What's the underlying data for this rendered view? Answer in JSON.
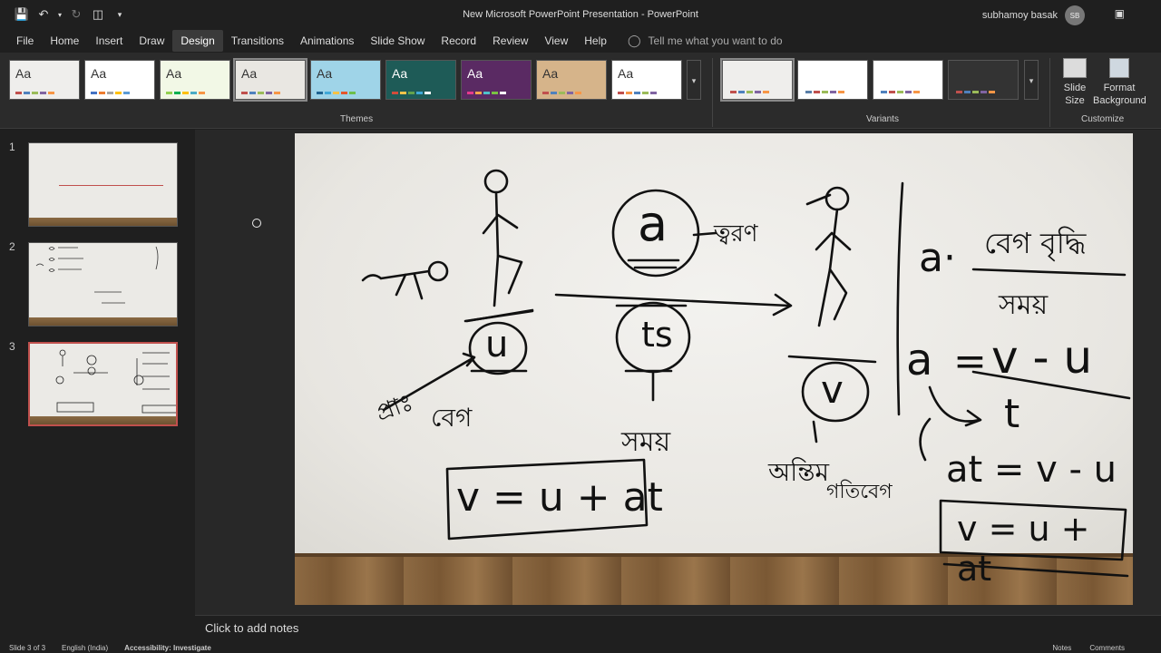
{
  "window": {
    "title": "New Microsoft PowerPoint Presentation  -  PowerPoint",
    "user_name": "subhamoy basak",
    "user_initials": "SB"
  },
  "menu": {
    "tabs": [
      "File",
      "Home",
      "Insert",
      "Draw",
      "Design",
      "Transitions",
      "Animations",
      "Slide Show",
      "Record",
      "Review",
      "View",
      "Help"
    ],
    "active_tab": "Design",
    "tell_me_placeholder": "Tell me what you want to do"
  },
  "ribbon": {
    "themes_label": "Themes",
    "variants_label": "Variants",
    "customize_label": "Customize",
    "slide_size_label": "Slide Size",
    "format_background_label": "Format Background",
    "theme_thumbnail_text": "Aa",
    "themes": [
      {
        "bg": "#efeeec",
        "fg": "#333333",
        "bars": [
          "#c0504d",
          "#4f81bd",
          "#9bbb59",
          "#8064a2",
          "#f79646"
        ]
      },
      {
        "bg": "#ffffff",
        "fg": "#333333",
        "bars": [
          "#4472c4",
          "#ed7d31",
          "#a5a5a5",
          "#ffc000",
          "#5b9bd5"
        ]
      },
      {
        "bg": "#f2f8e6",
        "fg": "#333333",
        "bars": [
          "#92d050",
          "#00b050",
          "#ffc000",
          "#4aacc6",
          "#f79646"
        ]
      },
      {
        "bg": "#e9e7e2",
        "fg": "#333333",
        "bars": [
          "#c0504d",
          "#4f81bd",
          "#9bbb59",
          "#8064a2",
          "#f79646"
        ]
      },
      {
        "bg": "#9fd4e8",
        "fg": "#333333",
        "bars": [
          "#1f6391",
          "#3fa9d8",
          "#f6c244",
          "#e5562c",
          "#6cbf4b"
        ]
      },
      {
        "bg": "#1e5b57",
        "fg": "#ffffff",
        "bars": [
          "#d14c3b",
          "#f1c24a",
          "#63a24c",
          "#3fa9d8",
          "#ffffff"
        ]
      },
      {
        "bg": "#5a2a63",
        "fg": "#ffffff",
        "bars": [
          "#e53a8c",
          "#f3a64a",
          "#4ec1ca",
          "#7ac142",
          "#ffffff"
        ]
      },
      {
        "bg": "#d6b48a",
        "fg": "#333333",
        "bars": [
          "#c0504d",
          "#4f81bd",
          "#9bbb59",
          "#8064a2",
          "#f79646"
        ]
      },
      {
        "bg": "#ffffff",
        "fg": "#333333",
        "bars": [
          "#c0504d",
          "#f79646",
          "#4f81bd",
          "#9bbb59",
          "#8064a2"
        ]
      }
    ],
    "variants": [
      {
        "bg": "#efeeec",
        "bars": [
          "#c0504d",
          "#4f81bd",
          "#9bbb59",
          "#8064a2",
          "#f79646"
        ]
      },
      {
        "bg": "#ffffff",
        "bars": [
          "#5a7fa8",
          "#c0504d",
          "#9bbb59",
          "#8064a2",
          "#f79646"
        ]
      },
      {
        "bg": "#ffffff",
        "bars": [
          "#4f81bd",
          "#c0504d",
          "#9bbb59",
          "#8064a2",
          "#f79646"
        ]
      },
      {
        "bg": "#333333",
        "bars": [
          "#c0504d",
          "#4f81bd",
          "#9bbb59",
          "#8064a2",
          "#f79646"
        ]
      }
    ]
  },
  "slides": {
    "numbers": [
      "1",
      "2",
      "3"
    ],
    "selected": 3
  },
  "slide3": {
    "handwriting": {
      "accel_symbol": "a",
      "accel_word": "ত্বরণ",
      "definition_top": "বেগ বৃদ্ধি",
      "definition_bottom": "সময়",
      "time_symbol": "ts",
      "time_word": "সময়",
      "init_symbol": "u",
      "init_word_1": "প্রাঃ",
      "init_word_2": "বেগ",
      "final_symbol": "v",
      "final_word_1": "অন্তিম",
      "final_word_2": "গতিবেগ",
      "formula_a_lhs": "a",
      "formula_a_num": "v - u",
      "formula_a_den": "t",
      "formula_at": "at = v - u",
      "result": "v = u + at"
    }
  },
  "notes": {
    "placeholder": "Click to add notes"
  },
  "status": {
    "slide_position": "Slide 3 of 3",
    "language": "English (India)",
    "accessibility": "Accessibility: Investigate",
    "notes_label": "Notes",
    "comments_label": "Comments"
  }
}
